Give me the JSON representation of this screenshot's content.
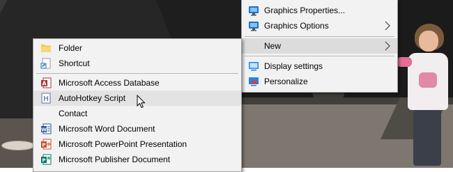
{
  "desktop_menu": {
    "items": [
      {
        "label": "Graphics Properties...",
        "icon": "intel-graphics-icon"
      },
      {
        "label": "Graphics Options",
        "icon": "intel-graphics-icon",
        "has_submenu": true
      },
      {
        "label": "New",
        "has_submenu": true,
        "highlighted": true
      },
      {
        "label": "Display settings",
        "icon": "display-settings-icon"
      },
      {
        "label": "Personalize",
        "icon": "personalize-icon"
      }
    ]
  },
  "new_submenu": {
    "items": [
      {
        "label": "Folder",
        "icon": "folder-icon"
      },
      {
        "label": "Shortcut",
        "icon": "shortcut-icon"
      },
      {
        "label": "Microsoft Access Database",
        "icon": "access-icon"
      },
      {
        "label": "AutoHotkey Script",
        "icon": "autohotkey-icon",
        "hovered": true
      },
      {
        "label": "Contact",
        "icon": "contact-icon"
      },
      {
        "label": "Microsoft Word Document",
        "icon": "word-icon"
      },
      {
        "label": "Microsoft PowerPoint Presentation",
        "icon": "powerpoint-icon"
      },
      {
        "label": "Microsoft Publisher Document",
        "icon": "publisher-icon"
      }
    ]
  },
  "colors": {
    "menu_bg": "#f2f2f2",
    "highlight": "#dcdcdc",
    "word_blue": "#2b579a",
    "powerpoint_red": "#d24726",
    "publisher_teal": "#077568",
    "access_red": "#a4373a",
    "folder_yellow": "#f3c650"
  }
}
